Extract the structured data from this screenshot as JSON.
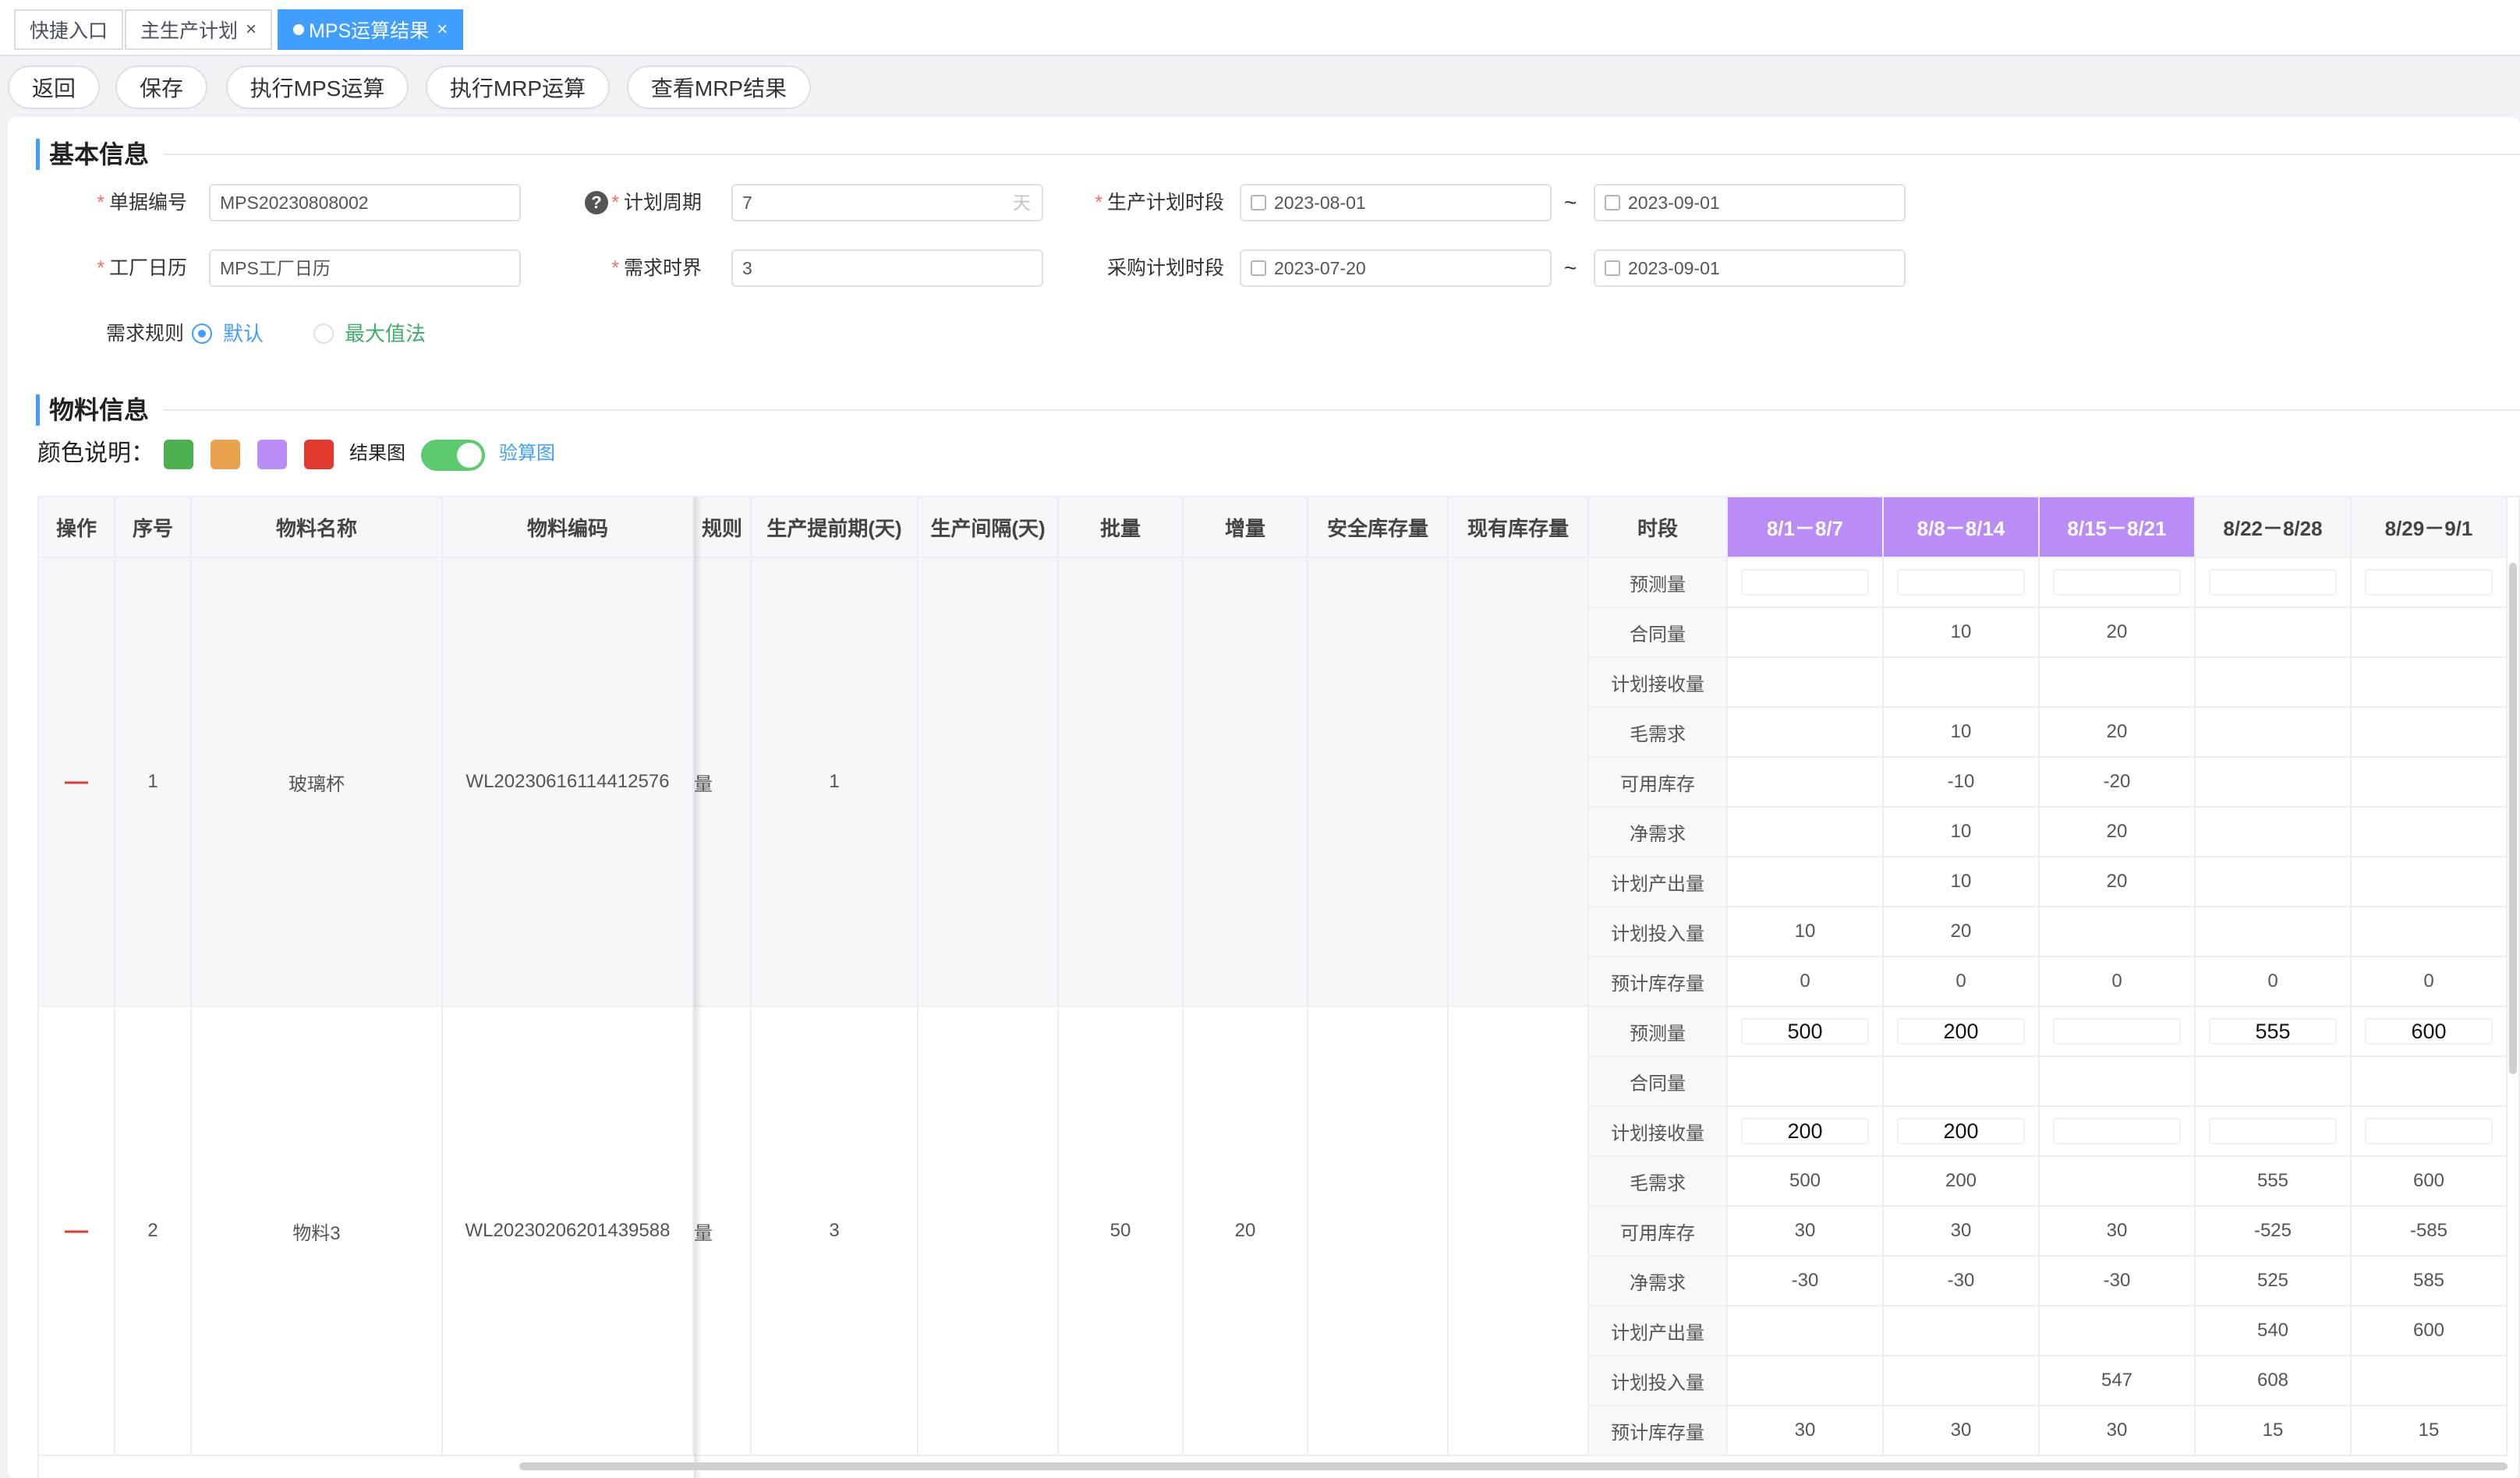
{
  "tabs": [
    {
      "label": "快捷入口",
      "closable": false,
      "active": false
    },
    {
      "label": "主生产计划",
      "closable": true,
      "active": false
    },
    {
      "label": "MPS运算结果",
      "closable": true,
      "active": true
    }
  ],
  "toolbar": {
    "back": "返回",
    "save": "保存",
    "run_mps": "执行MPS运算",
    "run_mrp": "执行MRP运算",
    "view_mrp": "查看MRP结果"
  },
  "basic_info": {
    "title": "基本信息",
    "required_mark": "*",
    "doc_no_label": "单据编号",
    "doc_no": "MPS20230808002",
    "cycle_label": "计划周期",
    "cycle": "7",
    "cycle_unit": "天",
    "prod_period_label": "生产计划时段",
    "prod_start": "2023-08-01",
    "prod_end": "2023-09-01",
    "tilde": "~",
    "calendar_label": "工厂日历",
    "calendar": "MPS工厂日历",
    "horizon_label": "需求时界",
    "horizon": "3",
    "purch_period_label": "采购计划时段",
    "purch_start": "2023-07-20",
    "purch_end": "2023-09-01",
    "rule_label": "需求规则",
    "rule_default": "默认",
    "rule_max": "最大值法",
    "rule_selected": "默认",
    "help_icon": "?"
  },
  "material_info": {
    "title": "物料信息",
    "color_legend_label": "颜色说明：",
    "colors": [
      "#4caf50",
      "#e8a24e",
      "#b98cf6",
      "#e03a2f"
    ],
    "result_chart_label": "结果图",
    "result_chart_on": true,
    "check_chart_link": "验算图"
  },
  "table": {
    "headers": {
      "op": "操作",
      "seq": "序号",
      "name": "物料名称",
      "code": "物料编码",
      "rule": "规则",
      "lead": "生产提前期(天)",
      "interval": "生产间隔(天)",
      "batch": "批量",
      "increment": "增量",
      "safety": "安全库存量",
      "onhand": "现有库存量",
      "period": "时段"
    },
    "periods": [
      "8/1－8/7",
      "8/8－8/14",
      "8/15－8/21",
      "8/22－8/28",
      "8/29－9/1"
    ],
    "row_labels": [
      "预测量",
      "合同量",
      "计划接收量",
      "毛需求",
      "可用库存",
      "净需求",
      "计划产出量",
      "计划投入量",
      "预计库存量"
    ],
    "groups": [
      {
        "op": "—",
        "seq": "1",
        "name": "玻璃杯",
        "code": "WL20230616114412576",
        "rule": "量",
        "lead": "1",
        "interval": "",
        "batch": "",
        "increment": "",
        "safety": "",
        "onhand": "",
        "values": [
          [
            "",
            "",
            "",
            "",
            ""
          ],
          [
            "",
            "10",
            "20",
            "",
            ""
          ],
          [
            "",
            "",
            "",
            "",
            ""
          ],
          [
            "",
            "10",
            "20",
            "",
            ""
          ],
          [
            "",
            "-10",
            "-20",
            "",
            ""
          ],
          [
            "",
            "10",
            "20",
            "",
            ""
          ],
          [
            "",
            "10",
            "20",
            "",
            ""
          ],
          [
            "10",
            "20",
            "",
            "",
            ""
          ],
          [
            "0",
            "0",
            "0",
            "0",
            "0"
          ]
        ]
      },
      {
        "op": "—",
        "seq": "2",
        "name": "物料3",
        "code": "WL20230206201439588",
        "rule": "量",
        "lead": "3",
        "interval": "",
        "batch": "50",
        "increment": "20",
        "safety": "",
        "onhand": "",
        "values": [
          [
            "500",
            "200",
            "",
            "555",
            "600"
          ],
          [
            "",
            "",
            "",
            "",
            ""
          ],
          [
            "200",
            "200",
            "",
            "",
            ""
          ],
          [
            "500",
            "200",
            "",
            "555",
            "600"
          ],
          [
            "30",
            "30",
            "30",
            "-525",
            "-585"
          ],
          [
            "-30",
            "-30",
            "-30",
            "525",
            "585"
          ],
          [
            "",
            "",
            "",
            "540",
            "600"
          ],
          [
            "",
            "",
            "547",
            "608",
            ""
          ],
          [
            "30",
            "30",
            "30",
            "15",
            "15"
          ]
        ]
      }
    ]
  }
}
